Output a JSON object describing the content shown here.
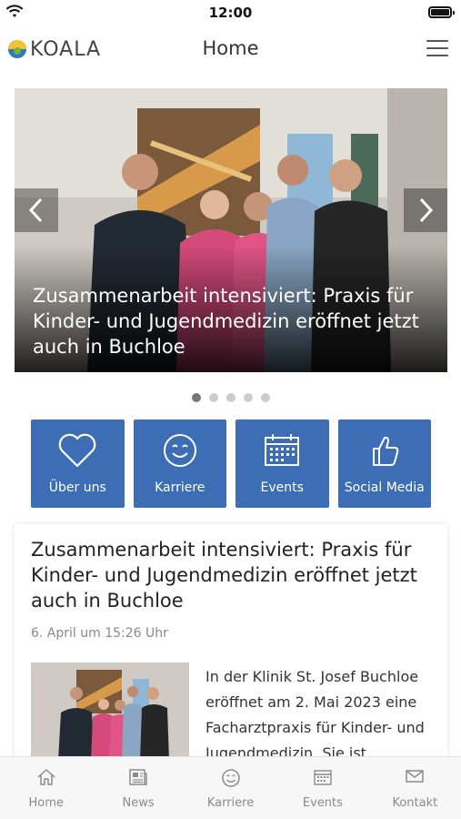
{
  "status_bar": {
    "time": "12:00"
  },
  "header": {
    "logo_text": "KOALA",
    "title": "Home",
    "menu_icon": "hamburger-menu-icon"
  },
  "hero": {
    "caption": "Zusammenarbeit intensiviert: Praxis für Kinder- und Jugendmedizin eröffnet jetzt auch in Buchloe",
    "slide_count": 5,
    "active_slide": 1
  },
  "tiles": [
    {
      "label": "Über uns",
      "icon": "heart-icon"
    },
    {
      "label": "Karriere",
      "icon": "smiley-icon"
    },
    {
      "label": "Events",
      "icon": "calendar-icon"
    },
    {
      "label": "Social Media",
      "icon": "thumbs-up-icon"
    }
  ],
  "article": {
    "title": "Zusammenarbeit intensiviert: Praxis für Kinder- und Jugendmedizin eröffnet jetzt auch in Buchloe",
    "date": "6. April um 15:26 Uhr",
    "excerpt": "In der Klinik St. Josef Buchloe eröffnet am 2. Mai 2023 eine Facharztpraxis für Kinder- und Jugendmedizin. Sie ist"
  },
  "tabbar": [
    {
      "label": "Home",
      "icon": "home-icon"
    },
    {
      "label": "News",
      "icon": "newspaper-icon"
    },
    {
      "label": "Karriere",
      "icon": "smiley-icon"
    },
    {
      "label": "Events",
      "icon": "calendar-icon"
    },
    {
      "label": "Kontakt",
      "icon": "mail-icon"
    }
  ],
  "colors": {
    "tile_blue": "#3d6eb5",
    "logo_yellow": "#f2c230",
    "logo_blue": "#2f78c4"
  }
}
